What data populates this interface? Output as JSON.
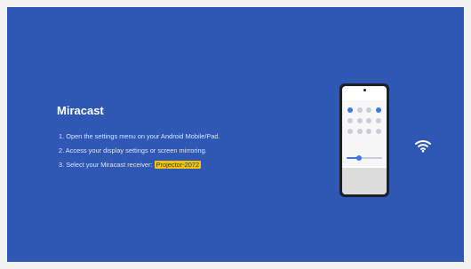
{
  "miracast": {
    "title": "Miracast",
    "steps": [
      "1. Open the settings menu on your Android Mobile/Pad.",
      "2. Access your display settings or screen mirroring.",
      "3. Select your Miracast receiver: "
    ],
    "receiver_name": "Projector-2072",
    "colors": {
      "background": "#2f58b4",
      "highlight": "#f5c400"
    },
    "icons": [
      "wifi-icon",
      "phone-illustration"
    ],
    "phone": {
      "brightness_level": 0.35
    }
  }
}
